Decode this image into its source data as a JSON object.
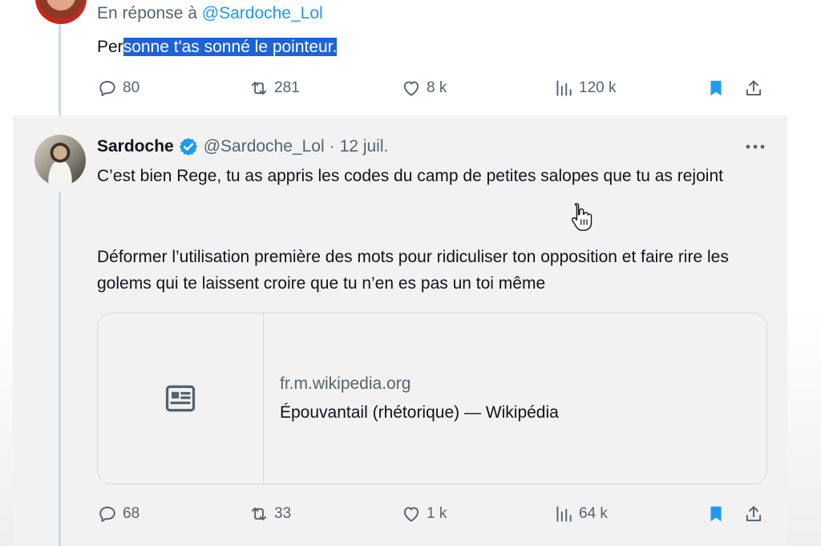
{
  "tweet_reply": {
    "reply_prefix": "En réponse à ",
    "reply_handle": "@Sardoche_Lol",
    "text_before_selection": "Per",
    "text_selected": "sonne t'as sonné le pointeur.",
    "actions": {
      "replies": "80",
      "retweets": "281",
      "likes": "8 k",
      "views": "120 k"
    },
    "bookmarked": true
  },
  "tweet_main": {
    "name": "Sardoche",
    "verified": true,
    "handle": "@Sardoche_Lol",
    "separator": "·",
    "date": "12 juil.",
    "paragraph_1": "C’est bien Rege, tu as appris les codes du camp de petites salopes que tu as rejoint",
    "paragraph_2": "Déformer l’utilisation première des mots pour ridiculiser ton opposition et faire rire les golems qui te laissent croire que tu n’en es pas un toi même",
    "link_card": {
      "domain": "fr.m.wikipedia.org",
      "title": "Épouvantail (rhétorique) — Wikipédia"
    },
    "actions": {
      "replies": "68",
      "retweets": "33",
      "likes": "1 k",
      "views": "64 k"
    },
    "bookmarked": true
  },
  "colors": {
    "accent": "#1d9bf0",
    "selection": "#1e63d5",
    "secondary_text": "#536471",
    "highlight_background": "#f2f2f2"
  },
  "icons": [
    "reply-icon",
    "retweet-icon",
    "like-icon",
    "views-icon",
    "bookmark-icon",
    "share-icon",
    "verified-badge-icon",
    "more-icon",
    "article-icon",
    "hand-cursor-icon"
  ]
}
